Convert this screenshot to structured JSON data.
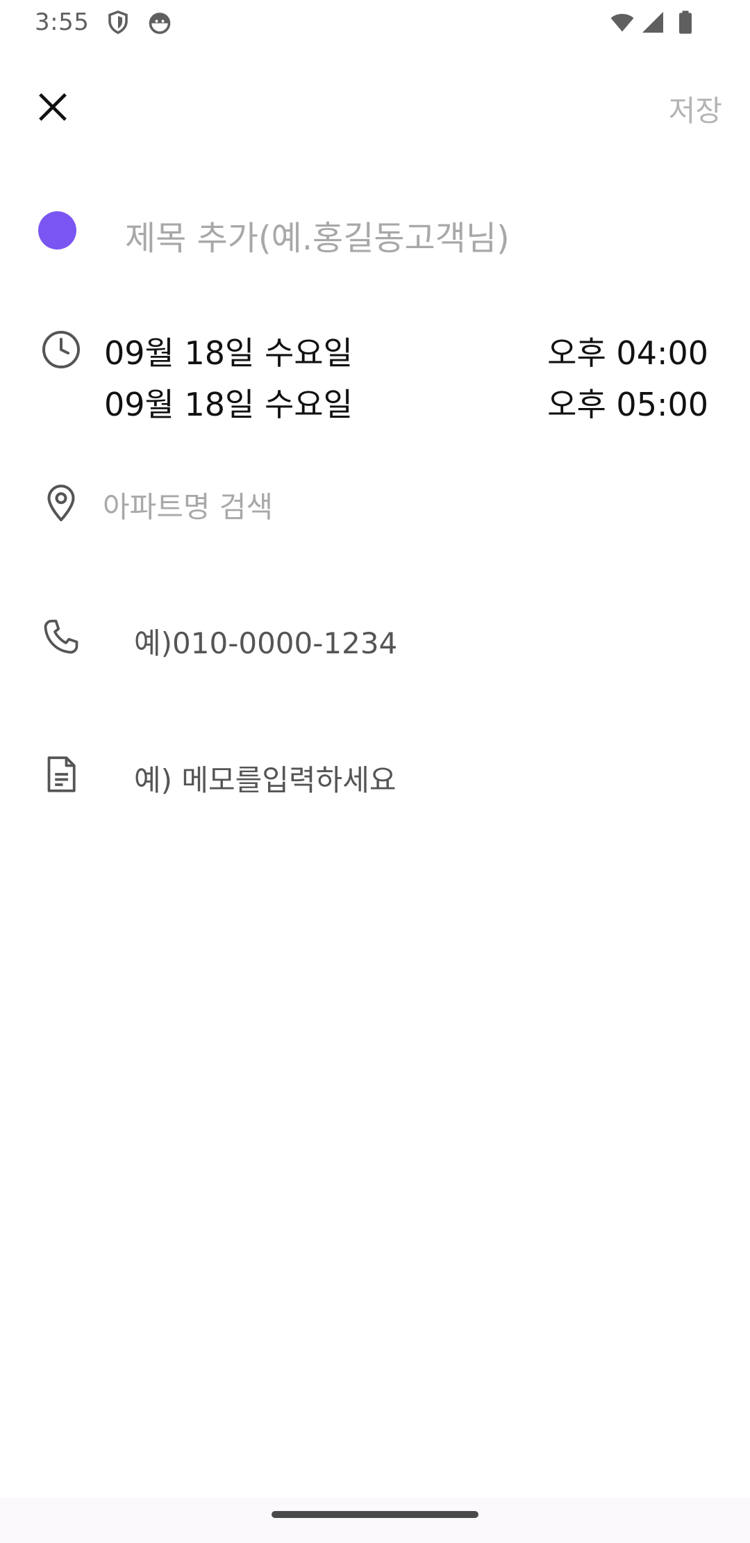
{
  "status_bar": {
    "time": "3:55",
    "icons": [
      "shield-icon",
      "android-head-icon",
      "wifi-icon",
      "signal-icon",
      "battery-icon"
    ]
  },
  "toolbar": {
    "close_icon": "close-icon",
    "save_label": "저장"
  },
  "event": {
    "color": "#7b55f1",
    "title_placeholder": "제목 추가(예.홍길동고객님)",
    "start_date": "09월 18일 수요일",
    "start_time": "오후 04:00",
    "end_date": "09월 18일 수요일",
    "end_time": "오후 05:00",
    "location_placeholder": "아파트명 검색",
    "phone_placeholder": "예)010-0000-1234",
    "memo_placeholder": "예) 메모를입력하세요"
  },
  "colors": {
    "accent": "#7b55f1",
    "placeholder": "#a8a8a8",
    "text": "#111111",
    "icon": "#555555"
  }
}
